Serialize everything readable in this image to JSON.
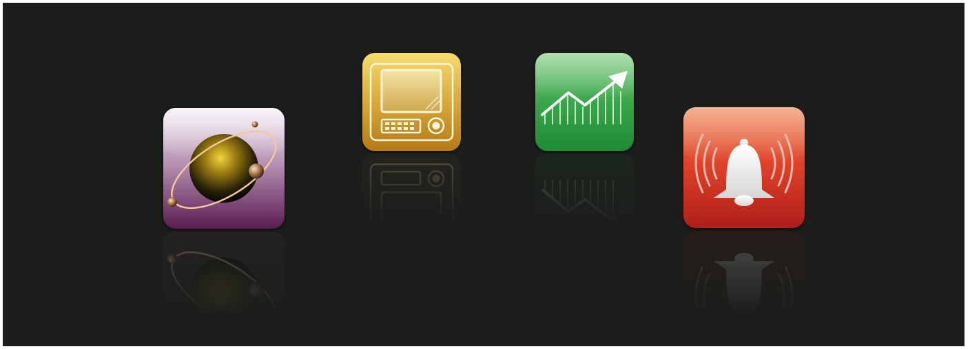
{
  "colors": {
    "background": "#1c1e1c",
    "page_border": "#ffffff"
  },
  "icons": [
    {
      "name": "orbit-app-icon",
      "semantic": "planet-with-orbiting-moons",
      "accent": "#7a2e6e"
    },
    {
      "name": "monitor-app-icon",
      "semantic": "tablet-monitor-device",
      "accent": "#c8921e"
    },
    {
      "name": "chart-app-icon",
      "semantic": "rising-stock-chart",
      "accent": "#2a9a3e"
    },
    {
      "name": "alarm-app-icon",
      "semantic": "ringing-bell-alarm",
      "accent": "#c8281e"
    }
  ]
}
